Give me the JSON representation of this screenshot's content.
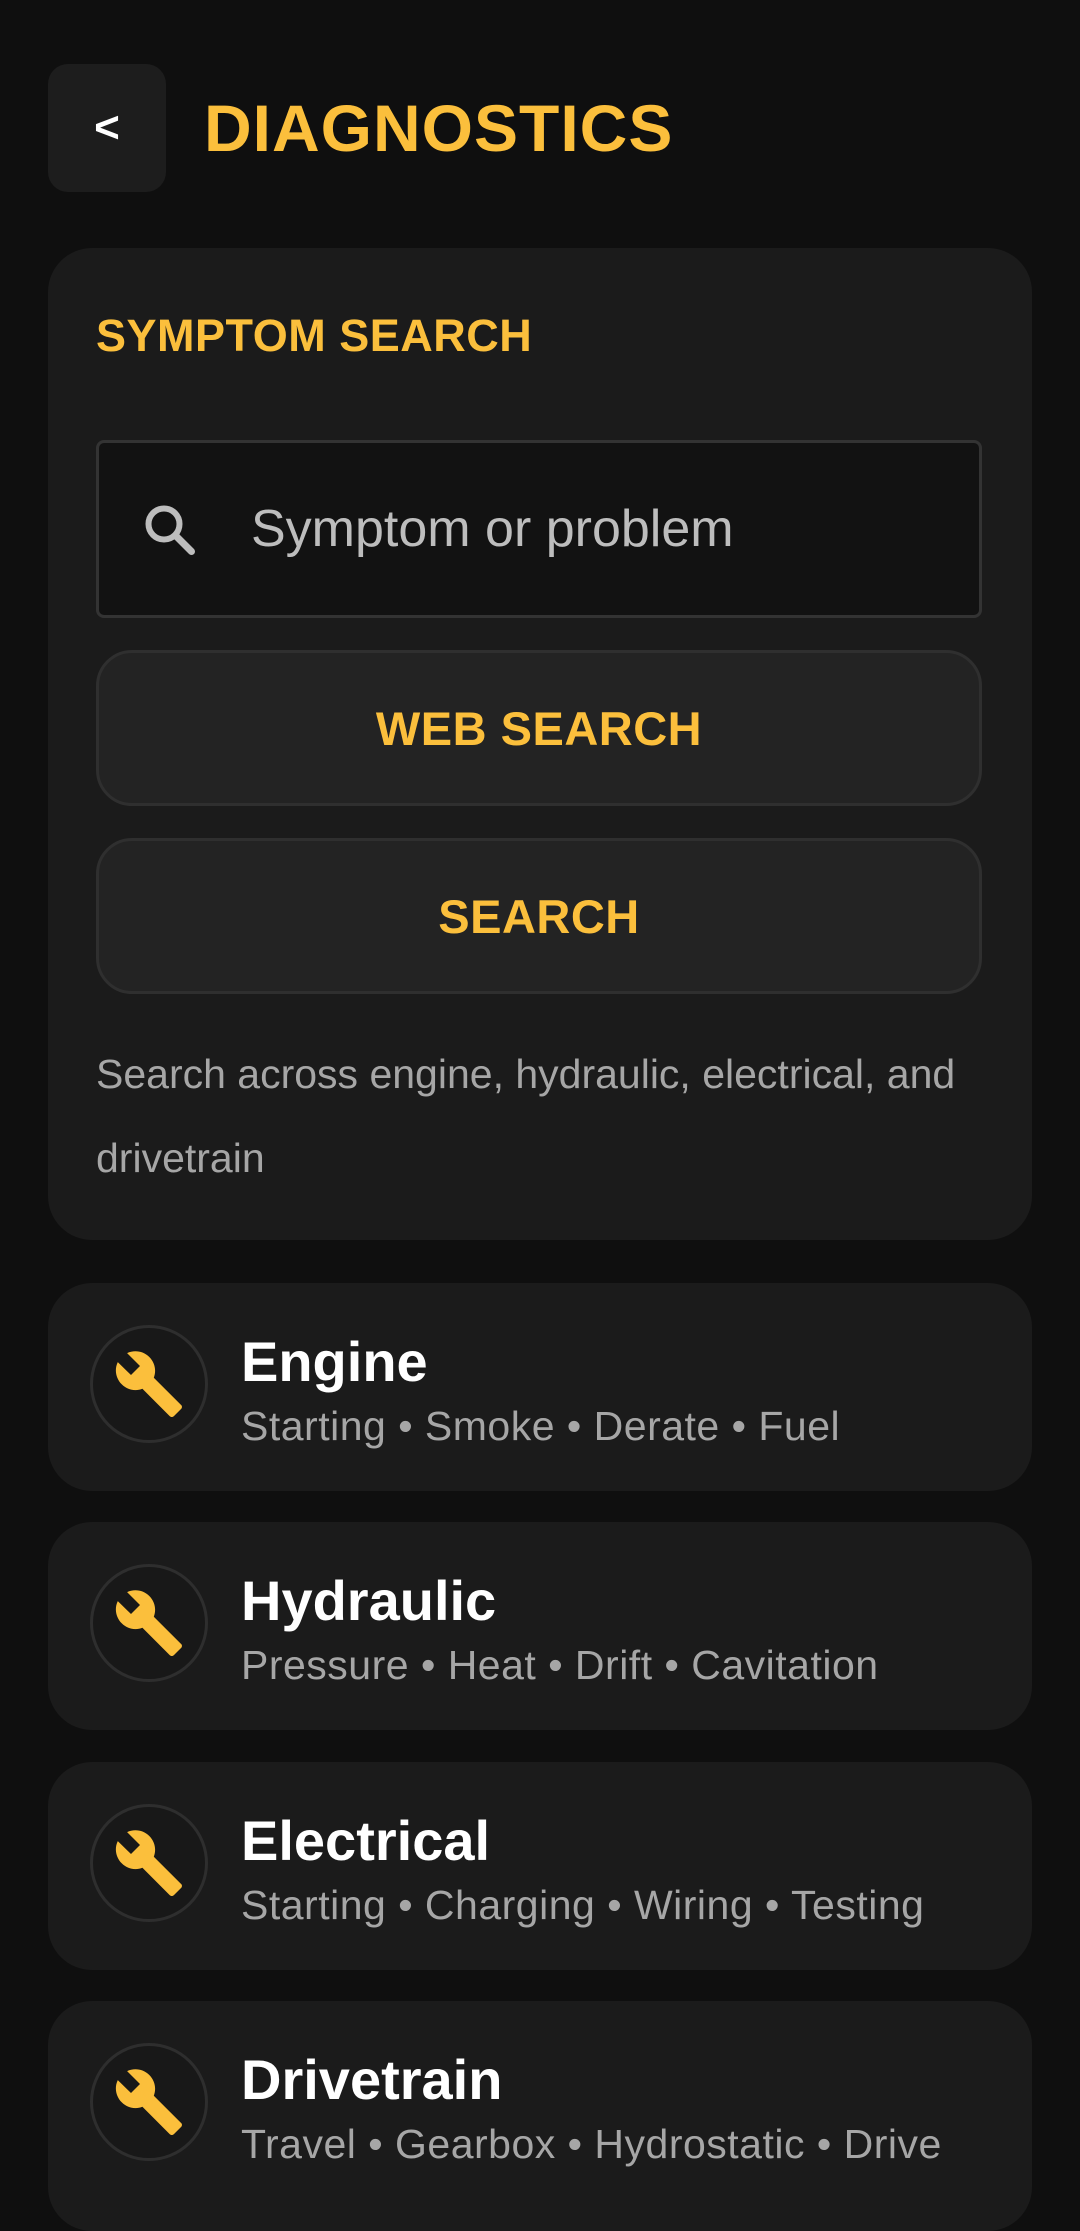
{
  "header": {
    "back_label": "<",
    "title": "DIAGNOSTICS"
  },
  "symptom_search": {
    "heading": "SYMPTOM SEARCH",
    "search": {
      "placeholder": "Symptom or problem",
      "value": ""
    },
    "web_search_label": "WEB SEARCH",
    "search_label": "SEARCH",
    "helper_text": "Search across engine, hydraulic, electrical, and drivetrain"
  },
  "categories": [
    {
      "title": "Engine",
      "subtitle": "Starting • Smoke • Derate • Fuel",
      "icon": "wrench-icon"
    },
    {
      "title": "Hydraulic",
      "subtitle": "Pressure • Heat • Drift • Cavitation",
      "icon": "wrench-icon"
    },
    {
      "title": "Electrical",
      "subtitle": "Starting • Charging • Wiring • Testing",
      "icon": "wrench-icon"
    },
    {
      "title": "Drivetrain",
      "subtitle": "Travel • Gearbox • Hydrostatic • Drive",
      "icon": "wrench-icon"
    }
  ],
  "colors": {
    "background": "#0f0f0f",
    "card": "#1b1b1b",
    "accent": "#fbbf3c",
    "muted_text": "#a6a6a6"
  }
}
